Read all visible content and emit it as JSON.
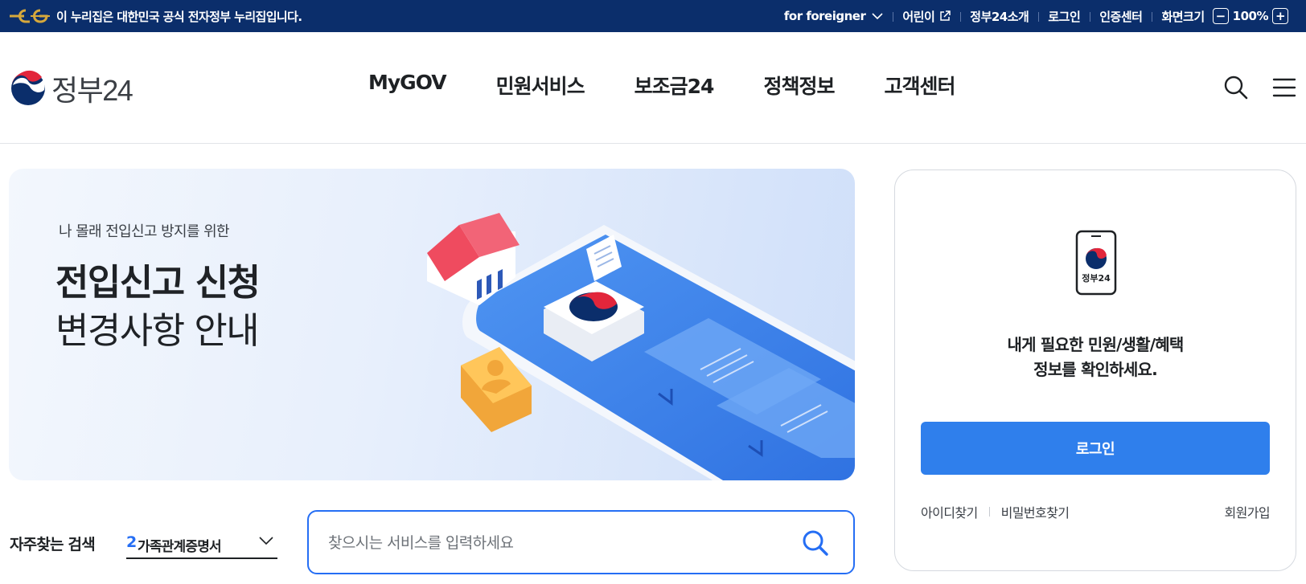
{
  "topbar": {
    "gov_notice": "이 누리집은 대한민국 공식 전자정부 누리집입니다.",
    "foreigner": "for foreigner",
    "kids": "어린이",
    "about": "정부24소개",
    "login": "로그인",
    "cert": "인증센터",
    "zoom_label": "화면크기",
    "zoom_minus": "−",
    "zoom_value": "100%",
    "zoom_plus": "+"
  },
  "header": {
    "logo_text": "정부24",
    "nav": [
      "MyGOV",
      "민원서비스",
      "보조금24",
      "정책정보",
      "고객센터"
    ],
    "icons": [
      "search-icon",
      "menu-icon"
    ]
  },
  "hero": {
    "subtitle": "나 몰래 전입신고 방지를 위한",
    "title_line1": "전입신고 신청",
    "title_line2": "변경사항 안내"
  },
  "search": {
    "fav_label": "자주찾는 검색",
    "fav_rank": "2",
    "fav_term": "가족관계증명서",
    "placeholder": "찾으시는 서비스를 입력하세요"
  },
  "login_card": {
    "phone_caption": "정부24",
    "message_line1": "내게 필요한 민원/생활/혜택",
    "message_line2": "정보를 확인하세요.",
    "login_button": "로그인",
    "find_id": "아이디찾기",
    "find_pw": "비밀번호찾기",
    "signup": "회원가입"
  },
  "colors": {
    "topbar": "#0b2e6b",
    "accent_blue": "#256ef4",
    "login_button": "#2f7fec",
    "gov_gold": "#c99a2e"
  }
}
